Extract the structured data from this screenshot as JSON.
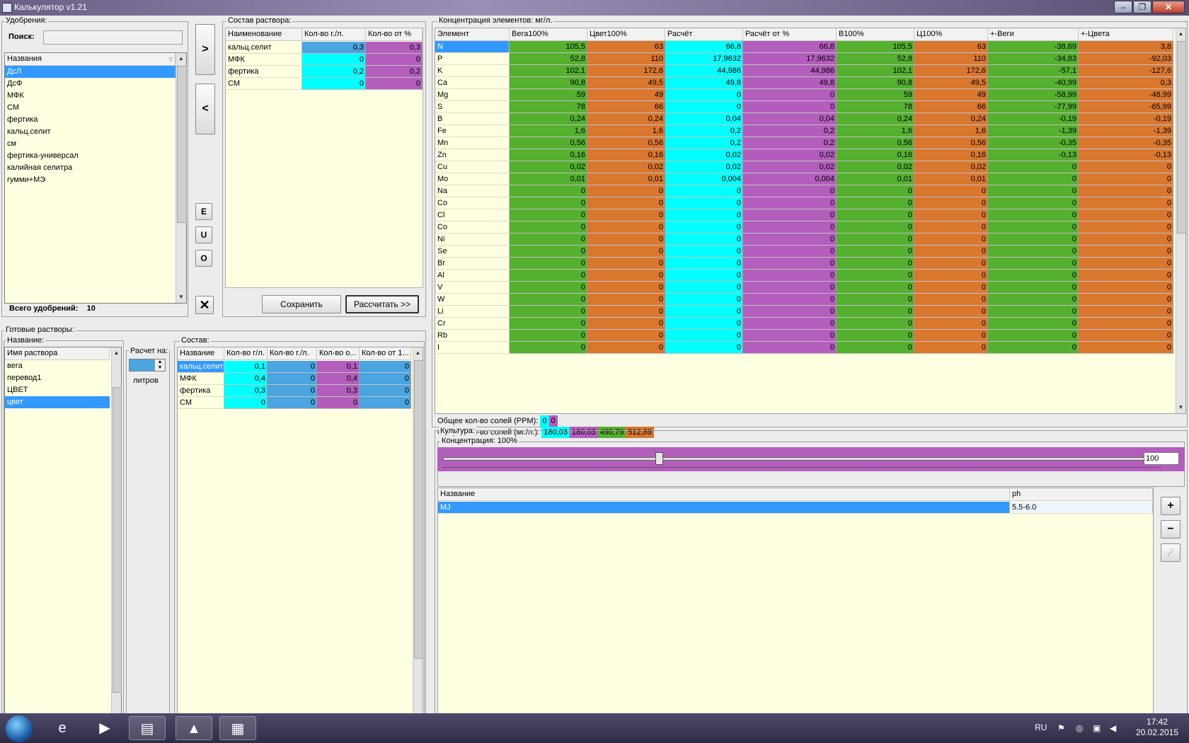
{
  "window": {
    "title": "Калькулятор v1.21"
  },
  "colors": {
    "cyan": "#00ffff",
    "magenta": "#b35dbd",
    "green": "#55b030",
    "orange": "#d9772f",
    "blue": "#4aa5e0",
    "selection": "#3399ff",
    "cream": "#ffffe1"
  },
  "fertilizers": {
    "group_label": "Удобрения:",
    "search_label": "Поиск:",
    "search_value": "",
    "column_header": "Названия",
    "items": [
      "ДсЛ",
      "ДсФ",
      "МФК",
      "СМ",
      "фертика",
      "кальц.селит",
      "см",
      "фертика-универсал",
      "калийная селитра",
      "гумми+МЭ"
    ],
    "selected_index": 0,
    "total_label": "Всего удобрений:",
    "total_value": "10"
  },
  "side_buttons": {
    "add": ">",
    "remove": "<",
    "e": "E",
    "u": "U",
    "o": "O",
    "delete": "✕"
  },
  "solution": {
    "group_label": "Состав раствора:",
    "headers": [
      "Наименование",
      "Кол-во г./л.",
      "Кол-во от %"
    ],
    "rows": [
      {
        "name": "кальц.селит",
        "qty": "0,3",
        "pct": "0,3"
      },
      {
        "name": "МФК",
        "qty": "0",
        "pct": "0"
      },
      {
        "name": "фертика",
        "qty": "0,2",
        "pct": "0,2"
      },
      {
        "name": "СМ",
        "qty": "0",
        "pct": "0"
      }
    ],
    "save_label": "Сохранить",
    "calc_label": "Рассчитать >>"
  },
  "ready": {
    "group_label": "Готовые растворы:",
    "name_group_label": "Название:",
    "column_header": "Имя раствора",
    "items": [
      "вега",
      "перевод1",
      "ЦВЕТ",
      "цвет"
    ],
    "selected_index": 3,
    "calc_per_label": "Расчет на:",
    "calc_per_value": "",
    "liters_label": "литров",
    "comp_group_label": "Состав:",
    "comp_headers": [
      "Название",
      "Кол-во г/л.",
      "Кол-во г./л.",
      "Кол-во о...",
      "Кол-во от 1..."
    ],
    "comp_rows": [
      {
        "name": "кальц.селит",
        "a": "0,1",
        "b": "0",
        "c": "0,1",
        "d": "0"
      },
      {
        "name": "МФК",
        "a": "0,4",
        "b": "0",
        "c": "0,4",
        "d": "0"
      },
      {
        "name": "фертика",
        "a": "0,3",
        "b": "0",
        "c": "0,3",
        "d": "0"
      },
      {
        "name": "СМ",
        "a": "0",
        "b": "0",
        "c": "0",
        "d": "0"
      }
    ]
  },
  "concentration": {
    "group_label": "Концентрация элементов: мг/л.",
    "headers": [
      "Элемент",
      "Вега100%",
      "Цвет100%",
      "Расчёт",
      "Расчёт от %",
      "В100%",
      "Ц100%",
      "+-Веги",
      "+-Цвета"
    ],
    "rows": [
      [
        "N",
        "105,5",
        "63",
        "66,8",
        "66,8",
        "105,5",
        "63",
        "-38,69",
        "3,8"
      ],
      [
        "P",
        "52,8",
        "110",
        "17,9632",
        "17,9632",
        "52,8",
        "110",
        "-34,83",
        "-92,03"
      ],
      [
        "K",
        "102,1",
        "172,6",
        "44,986",
        "44,986",
        "102,1",
        "172,6",
        "-57,1",
        "-127,6"
      ],
      [
        "Ca",
        "90,8",
        "49,5",
        "49,8",
        "49,8",
        "90,8",
        "49,5",
        "-40,99",
        "0,3"
      ],
      [
        "Mg",
        "59",
        "49",
        "0",
        "0",
        "59",
        "49",
        "-58,99",
        "-48,99"
      ],
      [
        "S",
        "78",
        "66",
        "0",
        "0",
        "78",
        "66",
        "-77,99",
        "-65,99"
      ],
      [
        "B",
        "0,24",
        "0,24",
        "0,04",
        "0,04",
        "0,24",
        "0,24",
        "-0,19",
        "-0,19"
      ],
      [
        "Fe",
        "1,6",
        "1,6",
        "0,2",
        "0,2",
        "1,6",
        "1,6",
        "-1,39",
        "-1,39"
      ],
      [
        "Mn",
        "0,56",
        "0,56",
        "0,2",
        "0,2",
        "0,56",
        "0,56",
        "-0,35",
        "-0,35"
      ],
      [
        "Zn",
        "0,16",
        "0,16",
        "0,02",
        "0,02",
        "0,16",
        "0,16",
        "-0,13",
        "-0,13"
      ],
      [
        "Cu",
        "0,02",
        "0,02",
        "0,02",
        "0,02",
        "0,02",
        "0,02",
        "0",
        "0"
      ],
      [
        "Mo",
        "0,01",
        "0,01",
        "0,004",
        "0,004",
        "0,01",
        "0,01",
        "0",
        "0"
      ],
      [
        "Na",
        "0",
        "0",
        "0",
        "0",
        "0",
        "0",
        "0",
        "0"
      ],
      [
        "Co",
        "0",
        "0",
        "0",
        "0",
        "0",
        "0",
        "0",
        "0"
      ],
      [
        "Cl",
        "0",
        "0",
        "0",
        "0",
        "0",
        "0",
        "0",
        "0"
      ],
      [
        "Co",
        "0",
        "0",
        "0",
        "0",
        "0",
        "0",
        "0",
        "0"
      ],
      [
        "Ni",
        "0",
        "0",
        "0",
        "0",
        "0",
        "0",
        "0",
        "0"
      ],
      [
        "Se",
        "0",
        "0",
        "0",
        "0",
        "0",
        "0",
        "0",
        "0"
      ],
      [
        "Br",
        "0",
        "0",
        "0",
        "0",
        "0",
        "0",
        "0",
        "0"
      ],
      [
        "Al",
        "0",
        "0",
        "0",
        "0",
        "0",
        "0",
        "0",
        "0"
      ],
      [
        "V",
        "0",
        "0",
        "0",
        "0",
        "0",
        "0",
        "0",
        "0"
      ],
      [
        "W",
        "0",
        "0",
        "0",
        "0",
        "0",
        "0",
        "0",
        "0"
      ],
      [
        "Li",
        "0",
        "0",
        "0",
        "0",
        "0",
        "0",
        "0",
        "0"
      ],
      [
        "Cr",
        "0",
        "0",
        "0",
        "0",
        "0",
        "0",
        "0",
        "0"
      ],
      [
        "Rb",
        "0",
        "0",
        "0",
        "0",
        "0",
        "0",
        "0",
        "0"
      ],
      [
        "I",
        "0",
        "0",
        "0",
        "0",
        "0",
        "0",
        "0",
        "0"
      ]
    ],
    "ppm_label": "Общее кол-во солей (PPM):",
    "ppm_values": [
      "0",
      "0"
    ],
    "mgl_label": "Общее кол-во солей (мг./л.):",
    "mgl_values": [
      "180,03",
      "180,03",
      "490,79",
      "512,69"
    ]
  },
  "culture": {
    "group_label": "Культура:",
    "conc_label": "Концентрация: 100%",
    "slider_percent": 30,
    "value": "100",
    "headers": [
      "Название",
      "ph"
    ],
    "rows": [
      {
        "name": "MJ",
        "ph": "5.5-6.0"
      }
    ],
    "plus": "+",
    "minus": "−",
    "chart": "⟋"
  },
  "taskbar": {
    "lang": "RU",
    "time": "17:42",
    "date": "20.02.2015"
  }
}
